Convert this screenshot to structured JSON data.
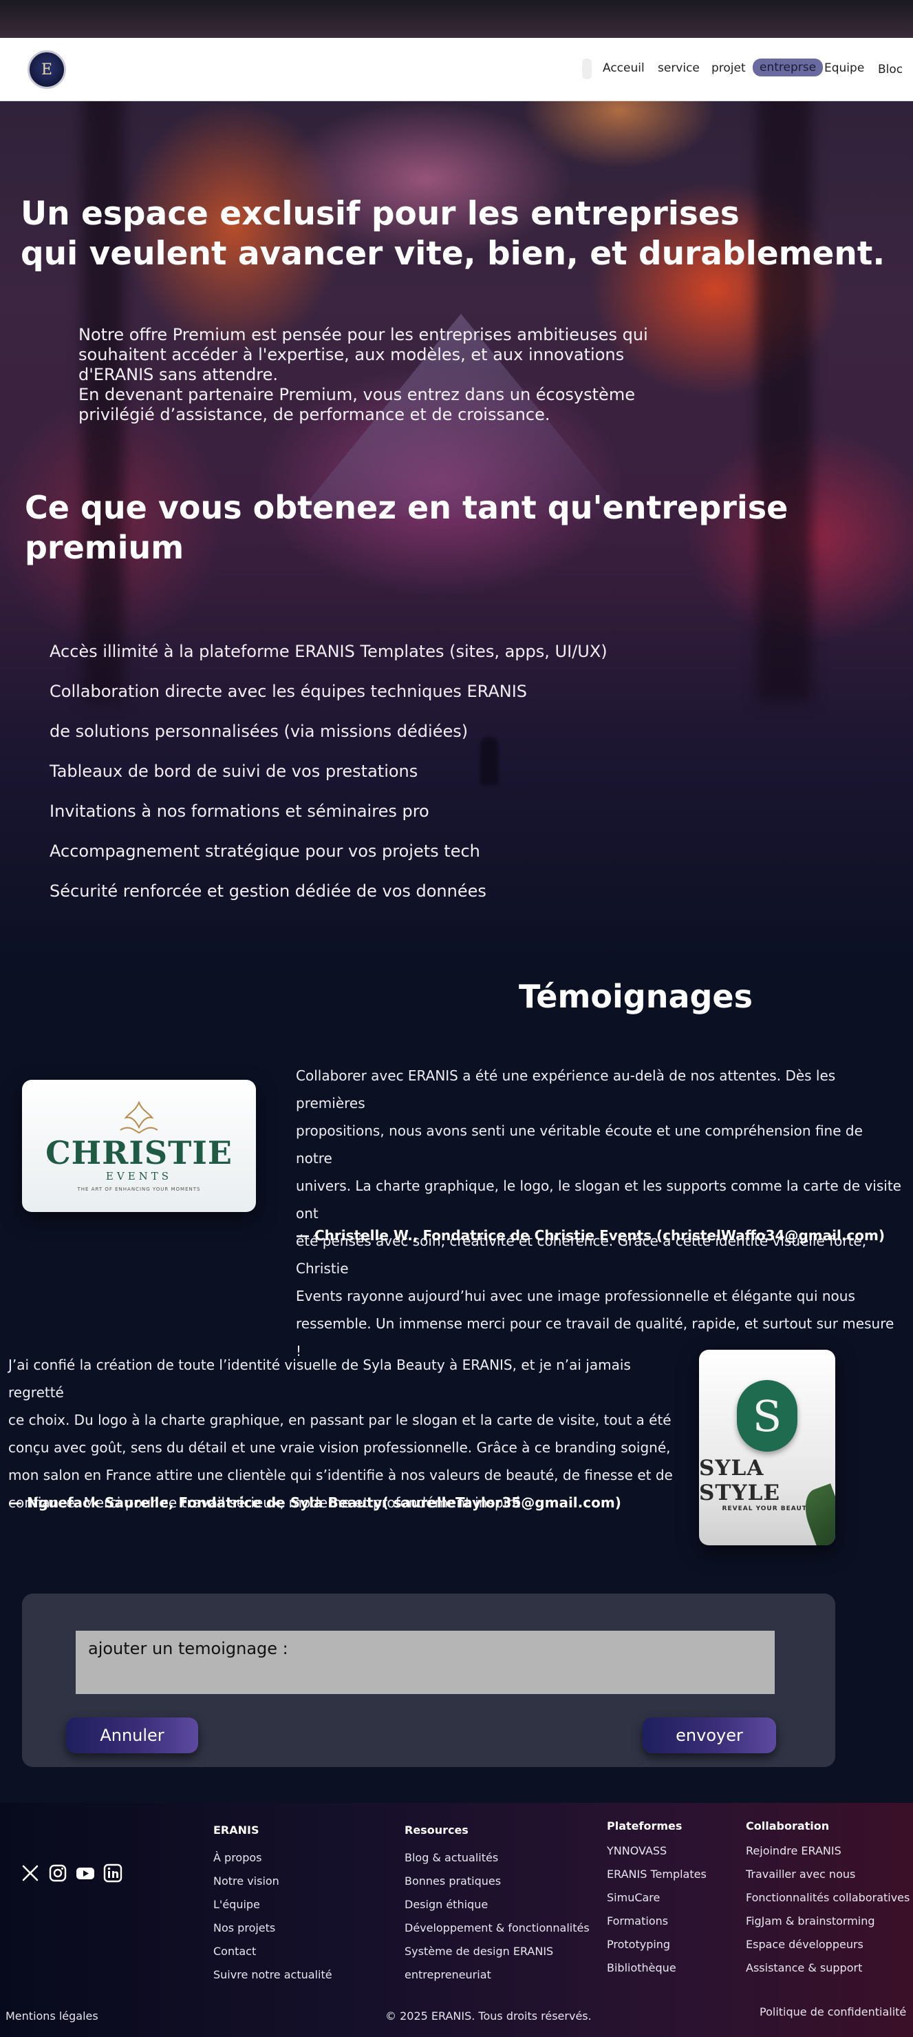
{
  "nav": {
    "logo_letter": "E",
    "items": [
      "Acceuil",
      "service",
      "projet",
      "entreprse",
      "Equipe",
      "Bloc"
    ],
    "active": "entreprse"
  },
  "hero": {
    "title": "Un espace exclusif pour les entreprises\nqui veulent avancer vite, bien, et durablement.",
    "intro": "Notre offre Premium est pensée pour les entreprises ambitieuses qui\nsouhaitent accéder à l'expertise, aux modèles, et aux innovations\nd'ERANIS sans attendre.\n En devenant partenaire Premium, vous entrez dans un écosystème\nprivilégié d’assistance, de performance et de croissance."
  },
  "benefits": {
    "title": "Ce que vous obtenez en tant qu'entreprise premium",
    "items": [
      "Accès illimité à la plateforme ERANIS Templates (sites, apps, UI/UX)",
      "Collaboration directe avec les équipes techniques ERANIS",
      " de solutions personnalisées (via missions dédiées)",
      "Tableaux de bord de suivi de vos prestations",
      "Invitations à nos formations et séminaires pro",
      "Accompagnement stratégique pour vos projets tech",
      "Sécurité renforcée et gestion dédiée de vos données"
    ]
  },
  "testimonials": {
    "title": "Témoignages",
    "christie": {
      "logo_name": "CHRISTIE",
      "logo_sub": "EVENTS",
      "logo_tag": "THE ART OF ENHANCING YOUR MOMENTS",
      "text": "Collaborer avec ERANIS   a été une expérience au-delà de nos attentes. Dès les premières\n propositions, nous avons senti une véritable écoute et une compréhension fine de notre\nunivers. La charte graphique, le logo, le slogan et les supports comme la carte de visite ont\nété pensés avec soin, créativité et cohérence. Grâce à cette identité visuelle forte, Christie\nEvents rayonne aujourd’hui avec une image professionnelle et élégante qui nous\nressemble. Un immense merci pour ce travail de qualité, rapide, et surtout sur mesure !",
      "author": "— Christelle W., Fondatrice de Christie Events (christelWaffo34@gmail.com)"
    },
    "syla": {
      "logo_letter": "S",
      "logo_name": "SYLA STYLE",
      "logo_sub": "REVEAL YOUR BEAUTY",
      "text": "J’ai confié la création de toute l’identité visuelle de Syla Beauty à ERANIS, et je n’ai jamais regretté\nce choix. Du logo à la charte graphique, en passant par le slogan et la carte de visite, tout a été\nconçu avec goût, sens du détail et une vraie vision professionnelle. Grâce à ce branding soigné,\nmon salon en France attire une clientèle qui s’identifie à nos valeurs de beauté, de finesse et de\nconfiance. Merci pour ce travail sérieux, moderne et profondément inspiré.",
      "author": "— Nguefack Saurelle, Fondatrice de Syla Beauty( saurelleTaylor35@gmail.com)"
    }
  },
  "form": {
    "placeholder": "ajouter un temoignage :",
    "cancel": "Annuler",
    "send": "envoyer"
  },
  "footer": {
    "social_icons": [
      "x-icon",
      "instagram-icon",
      "youtube-icon",
      "linkedin-icon"
    ],
    "eranis": {
      "title": "ERANIS",
      "items": [
        "À propos",
        "Notre vision",
        "L'équipe",
        "Nos projets",
        "Contact",
        "Suivre notre actualité"
      ]
    },
    "resources": {
      "title": "Resources",
      "items": [
        "Blog & actualités",
        "Bonnes pratiques",
        "Design éthique",
        "Développement & fonctionnalités",
        "Système de design ERANIS",
        "entrepreneuriat"
      ]
    },
    "platforms": {
      "title": "Plateformes",
      "items": [
        "YNNOVASS",
        "ERANIS Templates",
        "SimuCare",
        "Formations",
        "Prototyping",
        "Bibliothèque"
      ]
    },
    "collab": {
      "title": "Collaboration",
      "items": [
        "Rejoindre ERANIS",
        "Travailler avec nous",
        "Fonctionnalités collaboratives",
        "FigJam & brainstorming",
        "Espace développeurs",
        "Assistance & support"
      ]
    },
    "legal": "Mentions légales",
    "copyright": "© 2025 ERANIS. Tous droits réservés.",
    "privacy": "Politique de confidentialité"
  }
}
